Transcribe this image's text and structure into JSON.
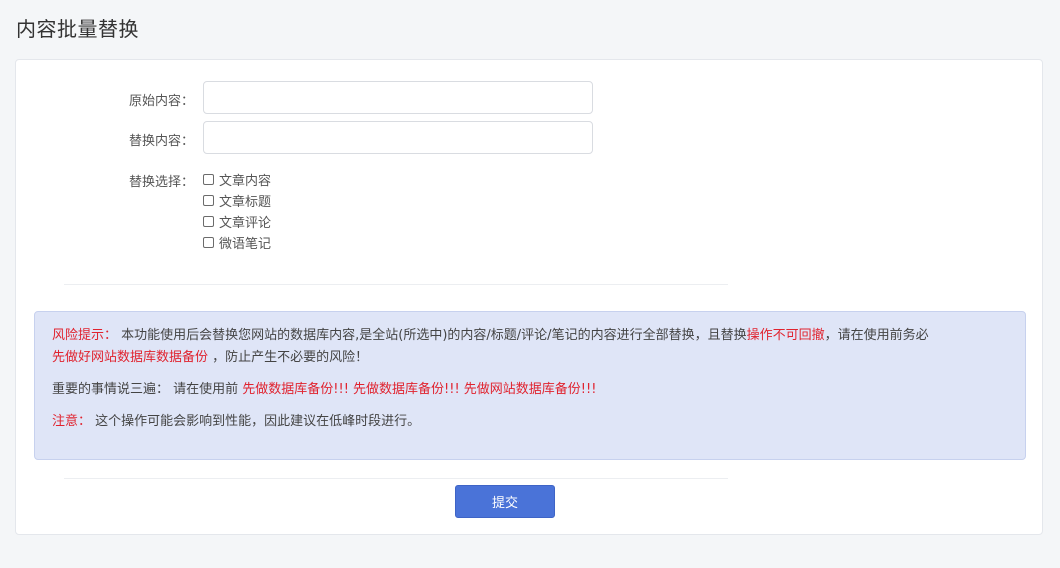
{
  "page": {
    "title": "内容批量替换"
  },
  "form": {
    "original_label": "原始内容：",
    "original_value": "",
    "replace_label": "替换内容：",
    "replace_value": "",
    "choice_label": "替换选择：",
    "choices": [
      {
        "label": "文章内容",
        "checked": false
      },
      {
        "label": "文章标题",
        "checked": false
      },
      {
        "label": "文章评论",
        "checked": false
      },
      {
        "label": "微语笔记",
        "checked": false
      }
    ]
  },
  "warning": {
    "p1_title": "风险提示：",
    "p1_text1": " 本功能使用后会替换您网站的数据库内容,是全站(所选中)的内容/标题/评论/笔记的内容进行全部替换，且替换",
    "p1_red1": "操作不可回撤",
    "p1_text2": "，请在使用前务必",
    "p1_red2": "先做好网站数据库数据备份",
    "p1_text3": " ，防止产生不必要的风险！",
    "p2_text": "重要的事情说三遍： 请在使用前 ",
    "p2_red": "先做数据库备份!!! 先做数据库备份!!! 先做网站数据库备份!!!",
    "p3_title": "注意：",
    "p3_text": " 这个操作可能会影响到性能，因此建议在低峰时段进行。"
  },
  "actions": {
    "submit_label": "提交"
  },
  "colors": {
    "accent": "#4a73d8",
    "warning_bg": "#dfe5f7",
    "danger": "#e0232f"
  }
}
